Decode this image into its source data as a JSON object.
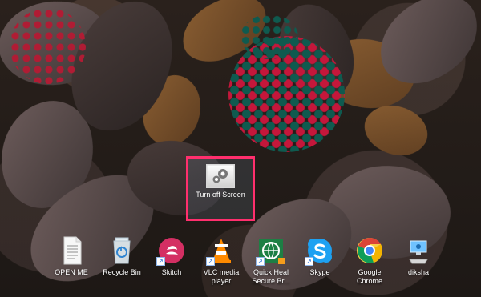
{
  "desktop": {
    "selected_item": {
      "label": "Turn off Screen",
      "icon": "gears-icon"
    },
    "icons": [
      {
        "label": "OPEN ME",
        "icon": "text-document-icon"
      },
      {
        "label": "Recycle Bin",
        "icon": "recycle-bin-icon"
      },
      {
        "label": "Skitch",
        "icon": "skitch-icon"
      },
      {
        "label": "VLC media player",
        "icon": "vlc-icon"
      },
      {
        "label": "Quick Heal Secure Br...",
        "icon": "globe-shield-icon"
      },
      {
        "label": "Skype",
        "icon": "skype-icon"
      },
      {
        "label": "Google Chrome",
        "icon": "chrome-icon"
      },
      {
        "label": "diksha",
        "icon": "user-computer-icon"
      }
    ],
    "highlight_color": "#ff2f6d"
  }
}
